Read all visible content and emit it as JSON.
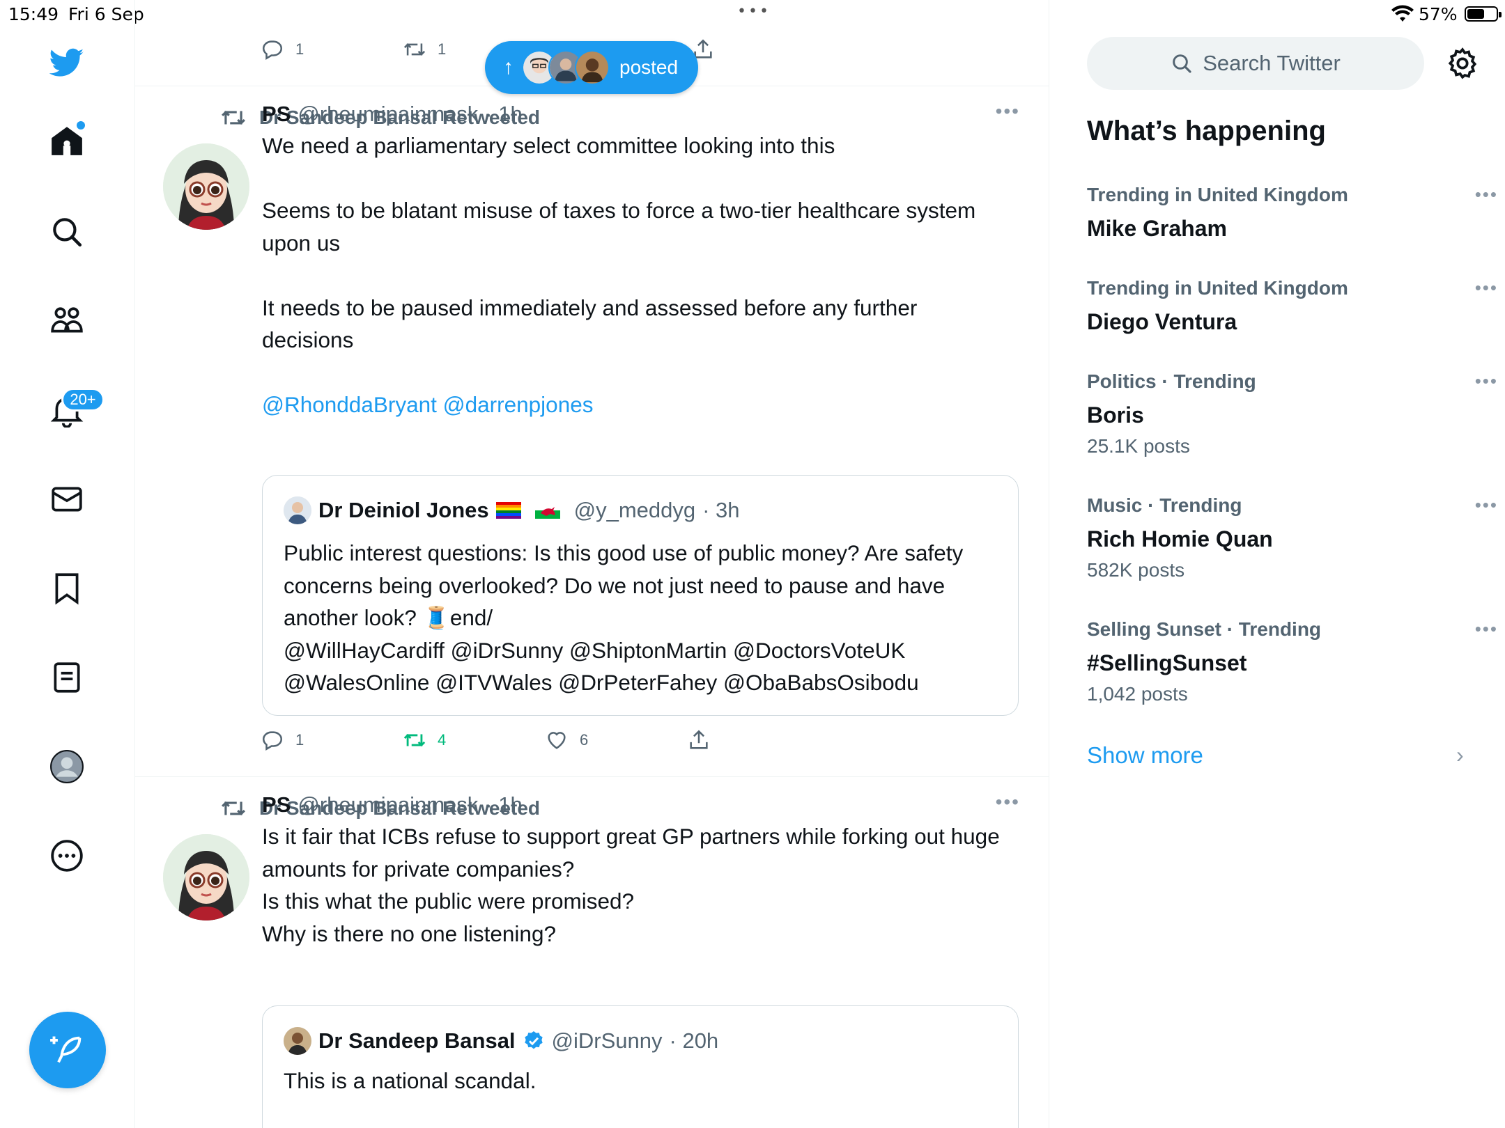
{
  "status_bar": {
    "time": "15:49",
    "date": "Fri 6 Sep",
    "battery": "57%"
  },
  "nav": {
    "notifications_badge": "20+"
  },
  "top_actions": {
    "reply_count": "1",
    "retweet_count": "1"
  },
  "posted_pill": {
    "label": "posted"
  },
  "tweets": [
    {
      "retweeted_by": "Dr Sandeep Bansal Retweeted",
      "name": "PS",
      "handle": "@rheumipainmask",
      "time": "· 1h",
      "text": "We need a parliamentary select committee looking into this\n\nSeems to be blatant misuse of taxes to  force a two-tier healthcare system upon us\n\nIt needs to be paused immediately and assessed before any further decisions\n\n",
      "mentions": "@RhonddaBryant @darrenpjones",
      "quote": {
        "name": "Dr Deiniol Jones",
        "handle": "@y_meddyg",
        "time": "· 3h",
        "text_a": "Public interest questions: Is this good use of public money? Are safety concerns being overlooked? Do we not just need to pause and have another look? 🧵end/",
        "text_b": "@WillHayCardiff @iDrSunny @ShiptonMartin @DoctorsVoteUK @WalesOnline @ITVWales @DrPeterFahey @ObaBabsOsibodu"
      },
      "reply_count": "1",
      "retweet_count": "4",
      "like_count": "6"
    },
    {
      "retweeted_by": "Dr Sandeep Bansal Retweeted",
      "name": "PS",
      "handle": "@rheumipainmask",
      "time": "· 1h",
      "text": "Is it fair that ICBs refuse to support great GP partners while forking out huge amounts for private companies?\nIs this what the public were promised?\nWhy is there no one listening?",
      "quote": {
        "name": "Dr Sandeep Bansal",
        "handle": "@iDrSunny",
        "time": "· 20h",
        "text": "This is a national scandal."
      }
    }
  ],
  "right": {
    "search_placeholder": "Search Twitter",
    "title": "What’s happening",
    "trends": [
      {
        "context": "Trending in United Kingdom",
        "topic": "Mike Graham",
        "count": ""
      },
      {
        "context": "Trending in United Kingdom",
        "topic": "Diego Ventura",
        "count": ""
      },
      {
        "context": "Politics · Trending",
        "topic": "Boris",
        "count": "25.1K posts"
      },
      {
        "context": "Music · Trending",
        "topic": "Rich Homie Quan",
        "count": "582K posts"
      },
      {
        "context": "Selling Sunset · Trending",
        "topic": "#SellingSunset",
        "count": "1,042 posts"
      }
    ],
    "show_more": "Show more"
  },
  "colors": {
    "accent": "#1d9bf0",
    "retweet_green": "#00ba7c",
    "muted": "#536471"
  }
}
